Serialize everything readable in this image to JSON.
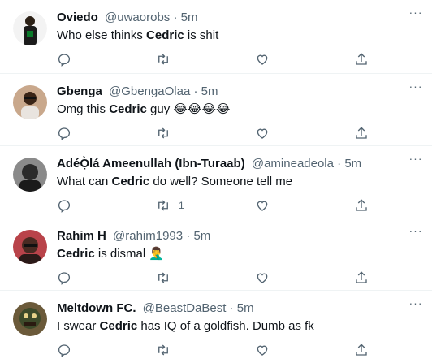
{
  "tweets": [
    {
      "name": "Oviedo",
      "handle": "@uwaorobs",
      "time": "5m",
      "text_before": "Who else thinks ",
      "highlight": "Cedric",
      "text_after": " is shit",
      "retweet_count": "",
      "avatar_color": "#1b1b1b"
    },
    {
      "name": "Gbenga",
      "handle": "@GbengaOlaa",
      "time": "5m",
      "text_before": "Omg this ",
      "highlight": "Cedric",
      "text_after": " guy",
      "emoji": "😂😂😂😂",
      "retweet_count": "",
      "avatar_color": "#b58d6d"
    },
    {
      "name": "AdéỌ̀lá Ameenullah (Ibn-Turaab)",
      "handle": "@amineadeola",
      "time": "5m",
      "text_before": "What can ",
      "highlight": "Cedric",
      "text_after": " do well? Someone tell me",
      "retweet_count": "1",
      "avatar_color": "#2a2a2a"
    },
    {
      "name": "Rahim H",
      "handle": "@rahim1993",
      "time": "5m",
      "text_before": "",
      "highlight": "Cedric",
      "text_after": " is dismal",
      "emoji": "🤦‍♂️",
      "retweet_count": "",
      "avatar_color": "#5a2f2a"
    },
    {
      "name": "Meltdown FC.",
      "handle": "@BeastDaBest",
      "time": "5m",
      "text_before": "I swear ",
      "highlight": "Cedric",
      "text_after": " has IQ of a goldfish. Dumb as fk",
      "retweet_count": "",
      "avatar_color": "#3d4a2a"
    }
  ],
  "dot": "·",
  "more_glyph": "···",
  "icons": {
    "reply": "reply-icon",
    "retweet": "retweet-icon",
    "like": "like-icon",
    "share": "share-icon"
  }
}
